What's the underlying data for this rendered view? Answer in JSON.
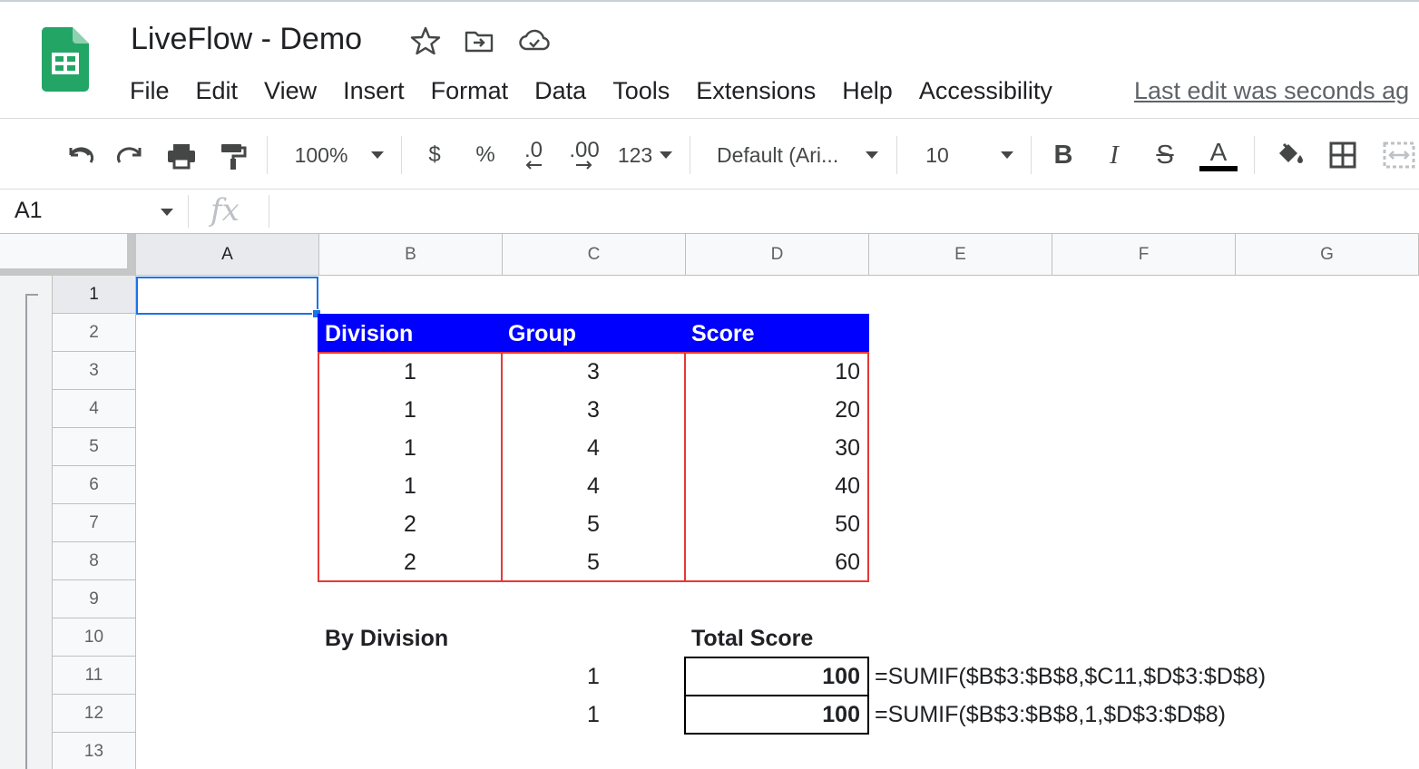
{
  "app": {
    "title": "LiveFlow - Demo",
    "menu": [
      "File",
      "Edit",
      "View",
      "Insert",
      "Format",
      "Data",
      "Tools",
      "Extensions",
      "Help",
      "Accessibility"
    ],
    "last_edit": "Last edit was seconds ag",
    "logo_color": "#23a566"
  },
  "toolbar": {
    "zoom": "100%",
    "currency": "$",
    "percent": "%",
    "decrease_decimals": ".0",
    "increase_decimals": ".00",
    "more_formats": "123",
    "font": "Default (Ari...",
    "font_size": "10",
    "bold": "B",
    "italic": "I",
    "strikethrough": "S",
    "text_color": "A"
  },
  "formula_bar": {
    "name_box": "A1",
    "fx_label": "fx",
    "content": ""
  },
  "grid": {
    "columns": [
      "A",
      "B",
      "C",
      "D",
      "E",
      "F",
      "G"
    ],
    "rows": [
      "1",
      "2",
      "3",
      "4",
      "5",
      "6",
      "7",
      "8",
      "9",
      "10",
      "11",
      "12",
      "13"
    ],
    "selected_cell": "A1",
    "header_color": "#0000ff",
    "border_color": "#e53935"
  },
  "sheet": {
    "table_headers": [
      "Division",
      "Group",
      "Score"
    ],
    "table_rows": [
      [
        "1",
        "3",
        "10"
      ],
      [
        "1",
        "3",
        "20"
      ],
      [
        "1",
        "4",
        "30"
      ],
      [
        "1",
        "4",
        "40"
      ],
      [
        "2",
        "5",
        "50"
      ],
      [
        "2",
        "5",
        "60"
      ]
    ],
    "by_division_label": "By Division",
    "total_score_label": "Total Score",
    "results": [
      {
        "division": "1",
        "total": "100",
        "formula": "=SUMIF($B$3:$B$8,$C11,$D$3:$D$8)"
      },
      {
        "division": "1",
        "total": "100",
        "formula": "=SUMIF($B$3:$B$8,1,$D$3:$D$8)"
      }
    ]
  }
}
